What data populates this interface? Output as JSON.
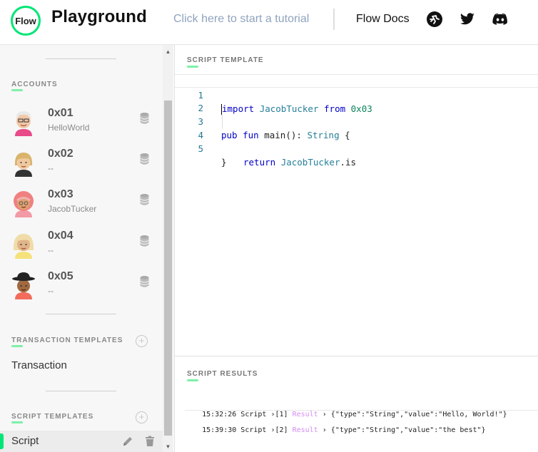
{
  "header": {
    "logo_text": "Flow",
    "title": "Playground",
    "tutorial_link": "Click here to start a tutorial",
    "docs_link": "Flow Docs",
    "icons": [
      "flow-runner-icon",
      "twitter-icon",
      "discord-icon"
    ]
  },
  "sidebar": {
    "accounts_label": "ACCOUNTS",
    "accounts": [
      {
        "address": "0x01",
        "name": "HelloWorld"
      },
      {
        "address": "0x02",
        "name": "--"
      },
      {
        "address": "0x03",
        "name": "JacobTucker"
      },
      {
        "address": "0x04",
        "name": "--"
      },
      {
        "address": "0x05",
        "name": "--"
      }
    ],
    "transaction_templates_label": "TRANSACTION TEMPLATES",
    "transaction_item": "Transaction",
    "script_templates_label": "SCRIPT TEMPLATES",
    "script_item": "Script"
  },
  "editor": {
    "label": "SCRIPT TEMPLATE",
    "lines": [
      "1",
      "2",
      "3",
      "4",
      "5"
    ],
    "code": {
      "l1_kw": "import",
      "l1_name": "JacobTucker",
      "l1_from": "from",
      "l1_addr": "0x03",
      "l3_pub": "pub",
      "l3_fun": "fun",
      "l3_main": "main(): ",
      "l3_type": "String",
      "l3_brace": " {",
      "l4_return": "return",
      "l4_expr": "JacobTucker",
      "l4_prop": ".is",
      "l5_brace": "}"
    }
  },
  "results": {
    "label": "SCRIPT RESULTS",
    "rows": [
      {
        "time": "15:32:26",
        "kind": "Script",
        "idx": "[1]",
        "tag": "Result",
        "value": "{\"type\":\"String\",\"value\":\"Hello, World!\"}"
      },
      {
        "time": "15:39:30",
        "kind": "Script",
        "idx": "[2]",
        "tag": "Result",
        "value": "{\"type\":\"String\",\"value\":\"the best\"}"
      }
    ]
  },
  "colors": {
    "accent": "#00e676",
    "result_tag": "#d38cf0",
    "tutorial_link": "#8fa3bf"
  }
}
